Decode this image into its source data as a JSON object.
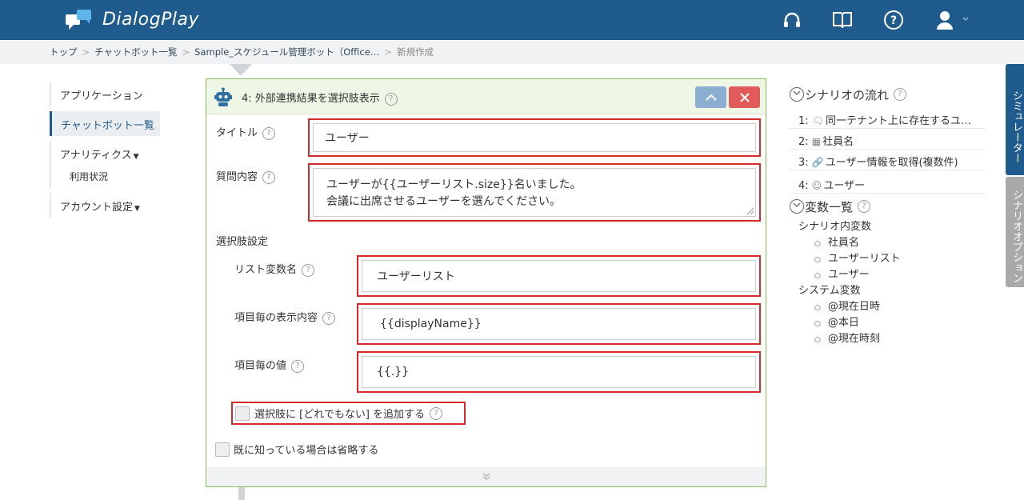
{
  "app": {
    "name": "DialogPlay"
  },
  "breadcrumb": [
    "トップ",
    "チャットボット一覧",
    "Sample_スケジュール管理ボット（Office…",
    "新規作成"
  ],
  "sidebar": {
    "items": [
      "アプリケーション",
      "チャットボット一覧",
      "アナリティクス",
      "利用状況",
      "アカウント設定"
    ]
  },
  "panel": {
    "title": "4: 外部連携結果を選択肢表示",
    "title_label": "タイトル",
    "title_value": "ユーザー",
    "question_label": "質問内容",
    "question_line1": "ユーザーが{{ユーザーリスト.size}}名いました。",
    "question_line2": "会議に出席させるユーザーを選んでください。",
    "choices_section": "選択肢設定",
    "list_var_label": "リスト変数名",
    "list_var_value": "ユーザーリスト",
    "display_label": "項目毎の表示内容",
    "display_value": "{{displayName}}",
    "value_label": "項目毎の値",
    "value_value": "{{.}}",
    "add_none_label": "選択肢に [どれでもない] を追加する",
    "skip_known_label": "既に知っている場合は省略する",
    "up_icon": "chevron-up",
    "close_icon": "x"
  },
  "right": {
    "flow_title": "シナリオの流れ",
    "flow_items": [
      {
        "num": "1:",
        "icon": "speech-bubble",
        "text": "同一テナント上に存在するユ…"
      },
      {
        "num": "2:",
        "icon": "calendar",
        "text": "社員名"
      },
      {
        "num": "3:",
        "icon": "link",
        "text": "ユーザー情報を取得(複数件)"
      },
      {
        "num": "4:",
        "icon": "robot",
        "text": "ユーザー"
      }
    ],
    "vars_title": "変数一覧",
    "scenario_vars_label": "シナリオ内変数",
    "scenario_vars": [
      "社員名",
      "ユーザーリスト",
      "ユーザー"
    ],
    "system_vars_label": "システム変数",
    "system_vars": [
      "@現在日時",
      "@本日",
      "@現在時刻"
    ]
  },
  "tabs": {
    "simulator": "シミュレーター",
    "scenario_options": "シナリオオプション"
  },
  "colors": {
    "header": "#205b8d",
    "highlight": "#d42a2a",
    "panel_border": "#8fb85e"
  }
}
